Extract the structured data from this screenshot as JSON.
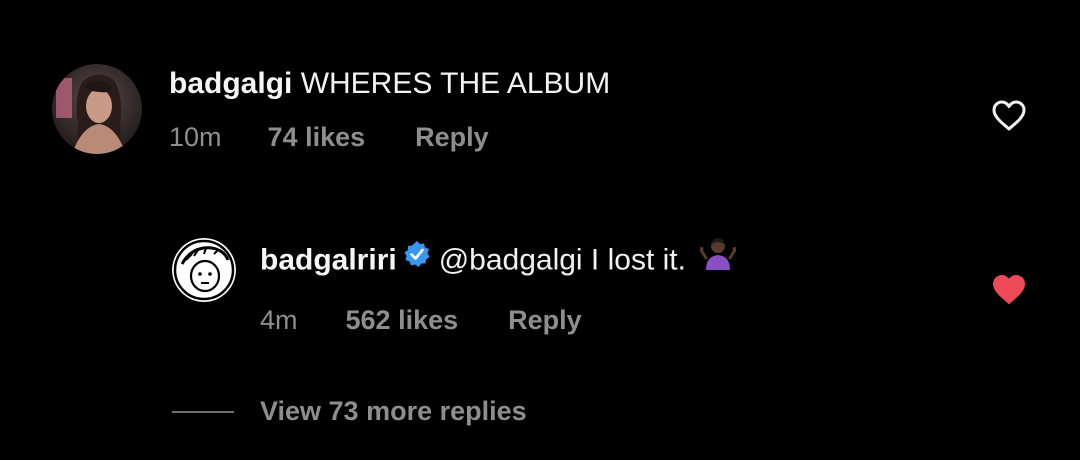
{
  "comments": [
    {
      "username": "badgalgi",
      "text": "WHERES THE ALBUM",
      "time": "10m",
      "likes": "74 likes",
      "reply": "Reply",
      "liked": false
    },
    {
      "username": "badgalriri",
      "verified": true,
      "text": "@badgalgi I lost it.",
      "emoji": "person-shrugging-emoji",
      "time": "4m",
      "likes": "562 likes",
      "reply": "Reply",
      "liked": true
    }
  ],
  "view_more_replies": "View 73 more replies",
  "colors": {
    "background": "#000000",
    "text": "#f2f2f2",
    "meta": "#8e8e8e",
    "liked_heart": "#ed4956",
    "verified_badge": "#3897f0"
  }
}
